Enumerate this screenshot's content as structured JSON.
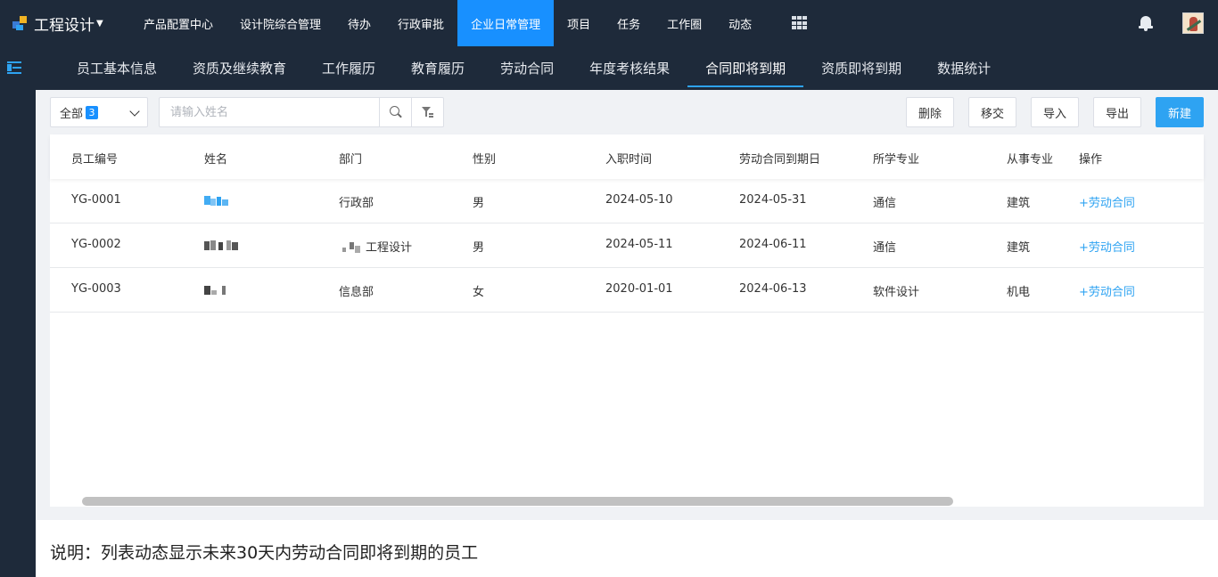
{
  "brand": {
    "title": "工程设计"
  },
  "topnav": {
    "items": [
      {
        "label": "产品配置中心",
        "active": false
      },
      {
        "label": "设计院综合管理",
        "active": false
      },
      {
        "label": "待办",
        "active": false
      },
      {
        "label": "行政审批",
        "active": false
      },
      {
        "label": "企业日常管理",
        "active": true
      },
      {
        "label": "项目",
        "active": false
      },
      {
        "label": "任务",
        "active": false
      },
      {
        "label": "工作圈",
        "active": false
      },
      {
        "label": "动态",
        "active": false
      }
    ]
  },
  "subtabs": {
    "items": [
      {
        "label": "员工基本信息"
      },
      {
        "label": "资质及继续教育"
      },
      {
        "label": "工作履历"
      },
      {
        "label": "教育履历"
      },
      {
        "label": "劳动合同"
      },
      {
        "label": "年度考核结果"
      },
      {
        "label": "合同即将到期"
      },
      {
        "label": "资质即将到期"
      },
      {
        "label": "数据统计"
      }
    ],
    "active_index": 6
  },
  "toolbar": {
    "filter_select": {
      "label": "全部",
      "count": "3"
    },
    "search": {
      "placeholder": "请输入姓名",
      "value": ""
    },
    "delete_label": "删除",
    "transfer_label": "移交",
    "import_label": "导入",
    "export_label": "导出",
    "new_label": "新建"
  },
  "table": {
    "columns": [
      "员工编号",
      "姓名",
      "部门",
      "性别",
      "入职时间",
      "劳动合同到期日",
      "所学专业",
      "从事专业",
      "操作"
    ],
    "rows": [
      {
        "id": "YG-0001",
        "dept": "行政部",
        "gender": "男",
        "hire_date": "2024-05-10",
        "contract_end": "2024-05-31",
        "major": "通信",
        "work_major": "建筑",
        "action": "+劳动合同"
      },
      {
        "id": "YG-0002",
        "dept": "工程设计",
        "gender": "男",
        "hire_date": "2024-05-11",
        "contract_end": "2024-06-11",
        "major": "通信",
        "work_major": "建筑",
        "action": "+劳动合同"
      },
      {
        "id": "YG-0003",
        "dept": "信息部",
        "gender": "女",
        "hire_date": "2020-01-01",
        "contract_end": "2024-06-13",
        "major": "软件设计",
        "work_major": "机电",
        "action": "+劳动合同"
      }
    ]
  },
  "footnote": "说明：列表动态显示未来30天内劳动合同即将到期的员工",
  "colors": {
    "topbar_bg": "#1e2a3a",
    "accent": "#1890ff",
    "link": "#2ea3f2",
    "content_bg": "#f0f2f5"
  }
}
